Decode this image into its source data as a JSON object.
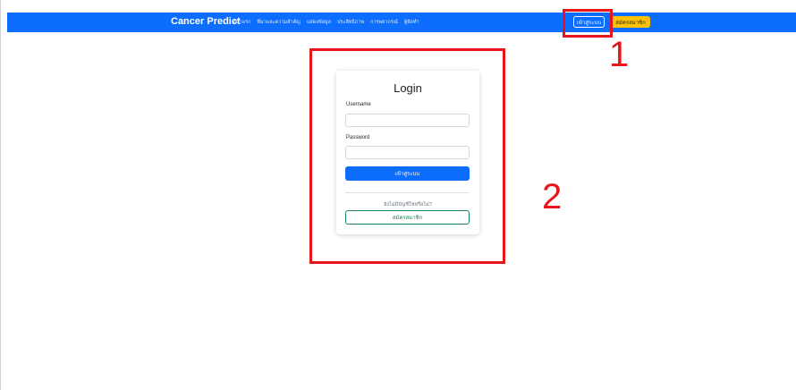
{
  "navbar": {
    "brand": "Cancer Predict",
    "links": [
      "หน้าแรก",
      "ที่มาและความสำคัญ",
      "แสดงข้อมูล",
      "ประสิทธิภาพ",
      "การพยากรณ์",
      "ผู้จัดทำ"
    ],
    "login_label": "เข้าสู่ระบบ",
    "register_label": "สมัครสมาชิก"
  },
  "login_card": {
    "title": "Login",
    "username_label": "Username",
    "username_value": "",
    "password_label": "Password",
    "password_value": "",
    "submit_label": "เข้าสู่ระบบ",
    "register_prompt": "ยังไม่มีบัญชีใช่หรือไม่?",
    "register_label": "สมัครสมาชิก"
  },
  "annotations": {
    "marker_1": "1",
    "marker_2": "2"
  },
  "colors": {
    "navbar": "#0d6efd",
    "primary": "#0d6efd",
    "warning": "#ffc107",
    "success": "#198754",
    "annotation": "#e8141b"
  }
}
